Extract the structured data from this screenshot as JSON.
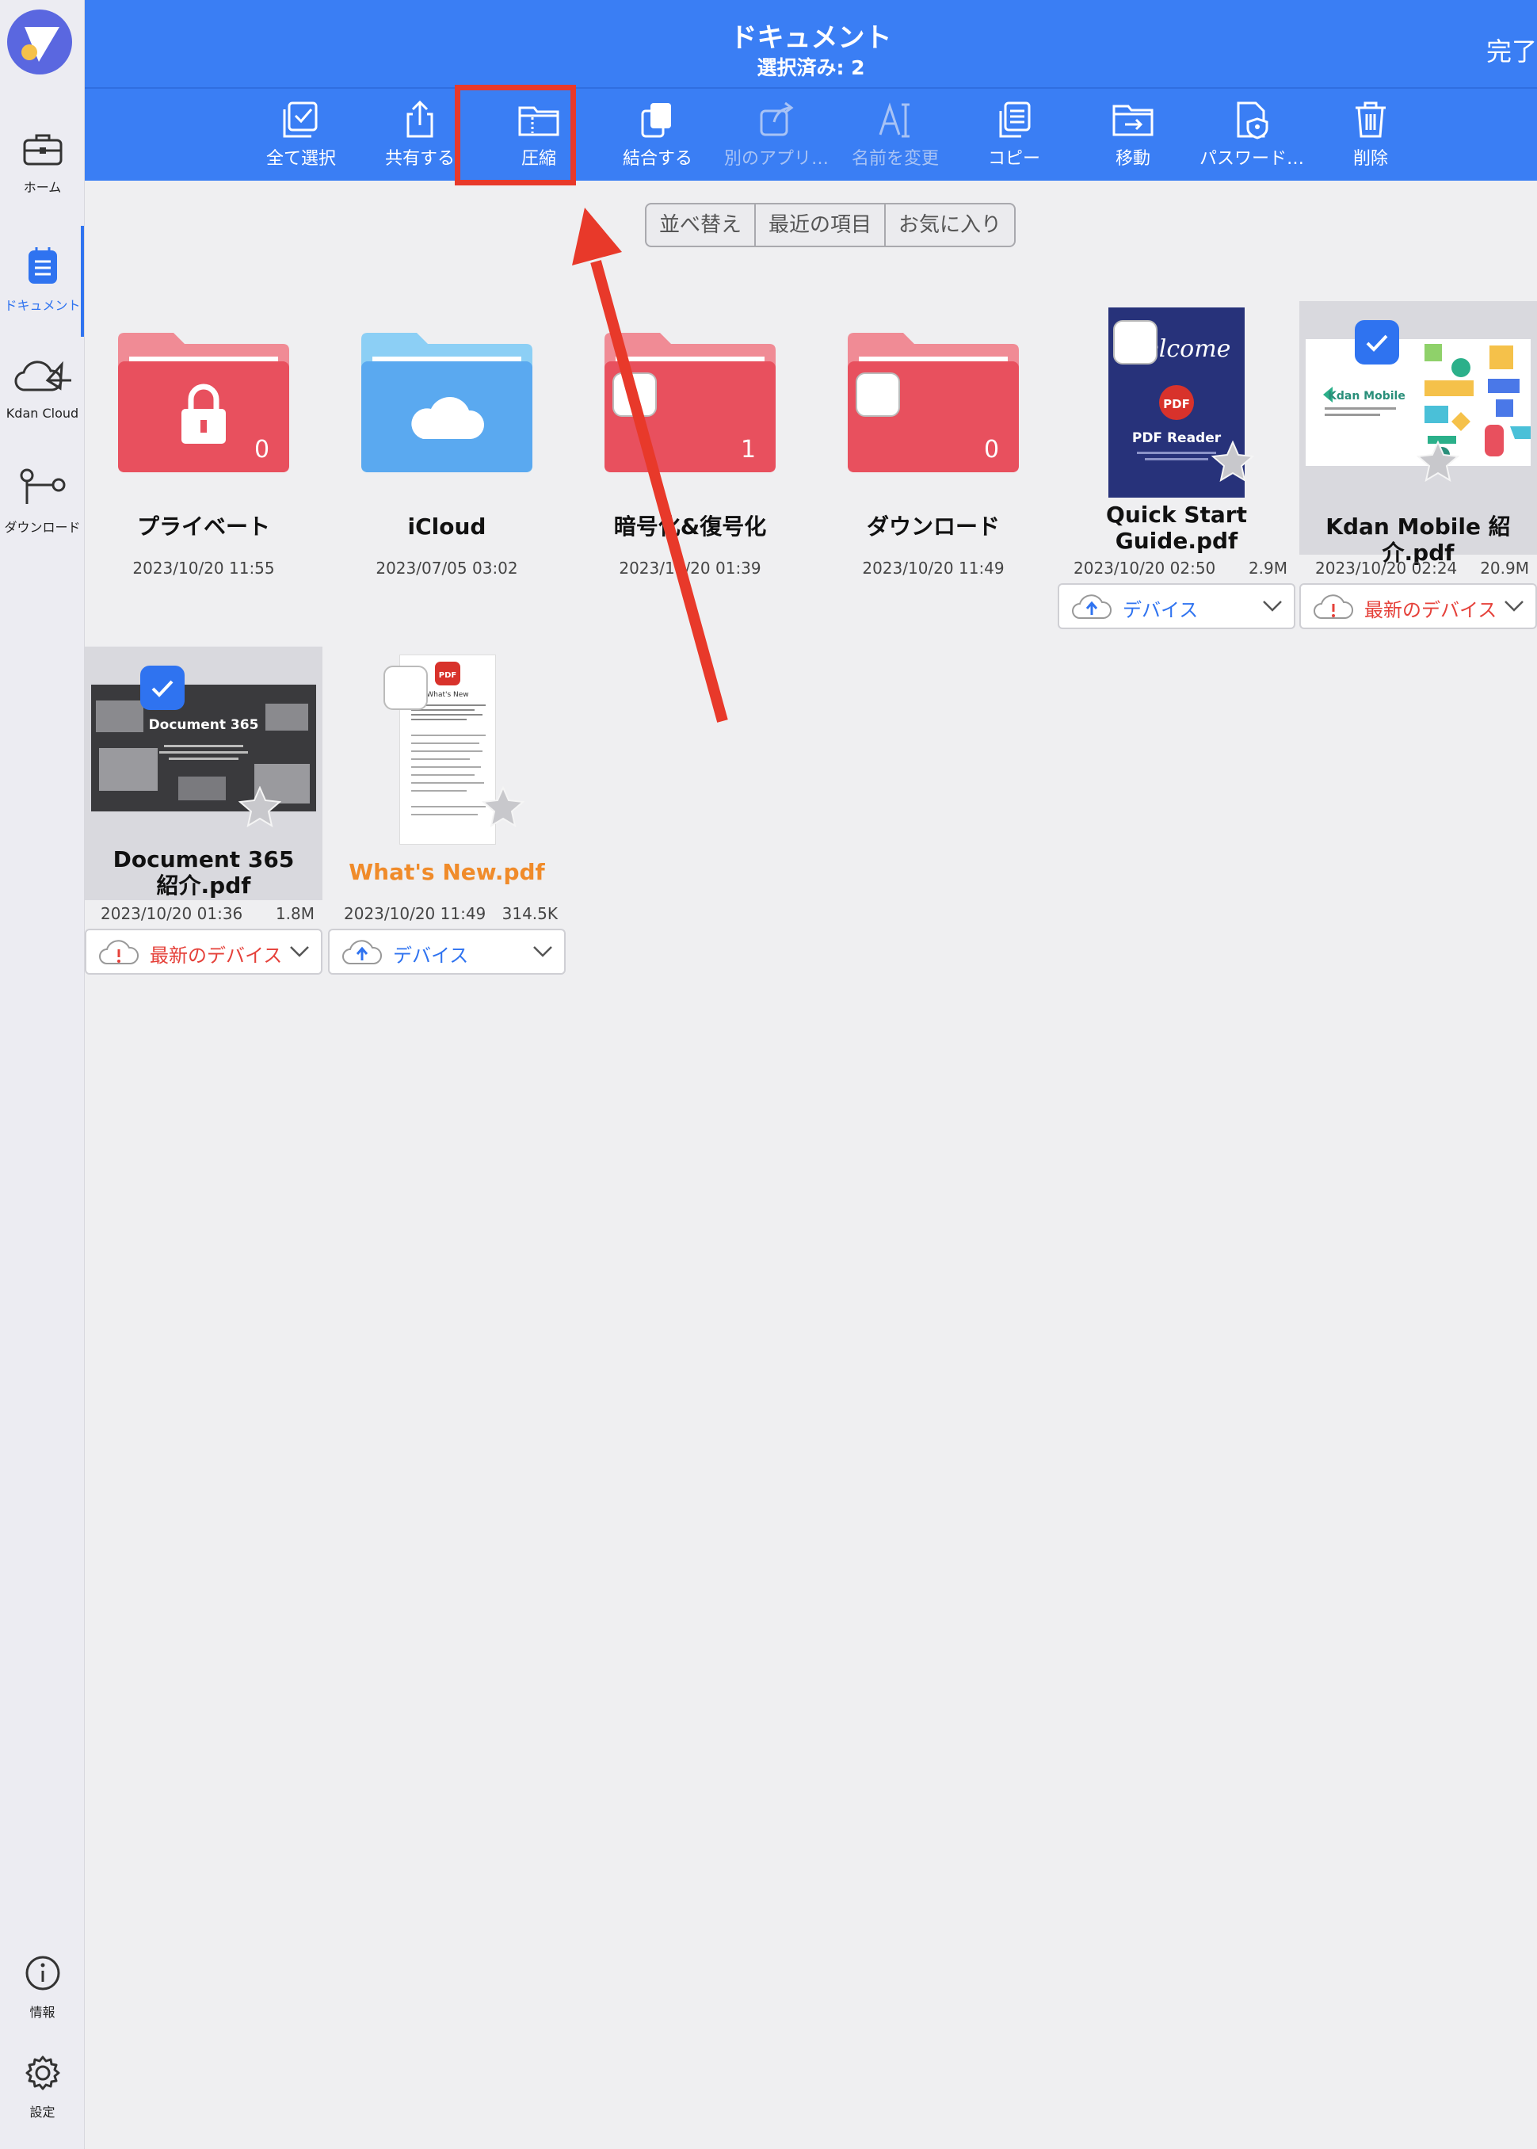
{
  "header": {
    "title": "ドキュメント",
    "subtitle": "選択済み: 2",
    "done_label": "完了"
  },
  "sidebar": {
    "items": [
      {
        "label": "ホーム",
        "icon": "toolbox-icon"
      },
      {
        "label": "ドキュメント",
        "icon": "document-icon",
        "active": true
      },
      {
        "label": "Kdan Cloud",
        "icon": "cloud-icon"
      },
      {
        "label": "ダウンロード",
        "icon": "download-icon"
      },
      {
        "label": "情報",
        "icon": "info-icon"
      },
      {
        "label": "設定",
        "icon": "gear-icon"
      }
    ]
  },
  "toolbar": {
    "select_all": "全て選択",
    "share": "共有する",
    "compress": "圧縮",
    "merge": "結合する",
    "other_app": "別のアプリ…",
    "rename": "名前を変更",
    "copy": "コピー",
    "move": "移動",
    "password": "パスワード…",
    "delete": "削除"
  },
  "sort": {
    "segments": [
      "並べ替え",
      "最近の項目",
      "お気に入り"
    ]
  },
  "items": [
    {
      "name": "プライベート",
      "date": "2023/10/20 11:55",
      "count": "0",
      "type": "folder-locked"
    },
    {
      "name": "iCloud",
      "date": "2023/07/05 03:02",
      "type": "folder-cloud"
    },
    {
      "name": "暗号化&復号化",
      "date": "2023/10/20 01:39",
      "count": "1",
      "type": "folder"
    },
    {
      "name": "ダウンロード",
      "date": "2023/10/20 11:49",
      "count": "0",
      "type": "folder"
    },
    {
      "name_line1": "Quick Start",
      "name_line2": "Guide.pdf",
      "date": "2023/10/20 02:50",
      "size": "2.9M",
      "sync": "デバイス",
      "thumb_title": "PDF Reader",
      "thumb_script": "Welcome"
    },
    {
      "name": "Kdan Mobile 紹介.pdf",
      "date": "2023/10/20 02:24",
      "size": "20.9M",
      "sync": "最新のデバイス",
      "selected": true,
      "thumb_title": "Kdan Mobile"
    },
    {
      "name_line1": "Document 365",
      "name_line2": "紹介.pdf",
      "date": "2023/10/20 01:36",
      "size": "1.8M",
      "sync": "最新のデバイス",
      "selected": true,
      "thumb_title": "Document 365"
    },
    {
      "name": "What's New.pdf",
      "date": "2023/10/20 11:49",
      "size": "314.5K",
      "sync": "デバイス",
      "thumb_title": "What's New"
    }
  ],
  "colors": {
    "brand_blue": "#3a7ef4",
    "folder_red": "#e8505e",
    "folder_blue": "#5aa9f0",
    "highlight": "#e8392a",
    "file_orange": "#f08b2a"
  }
}
